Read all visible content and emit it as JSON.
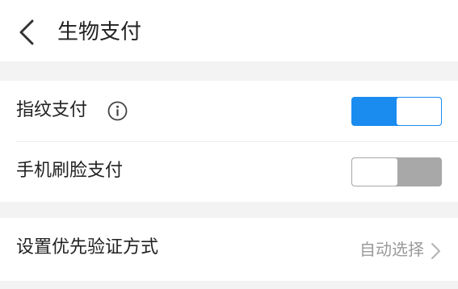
{
  "header": {
    "title": "生物支付",
    "back_icon": "back-chevron-icon"
  },
  "settings": {
    "fingerprint": {
      "label": "指纹支付",
      "info_icon": "info-icon",
      "enabled": true
    },
    "face": {
      "label": "手机刷脸支付",
      "enabled": false
    },
    "priority": {
      "label": "设置优先验证方式",
      "value": "自动选择",
      "chevron_icon": "chevron-right-icon"
    }
  },
  "colors": {
    "accent": "#1a8cf0",
    "toggle_off": "#a8a8a8",
    "background": "#f3f3f3",
    "text": "#222222",
    "secondary_text": "#9a9a9a"
  }
}
